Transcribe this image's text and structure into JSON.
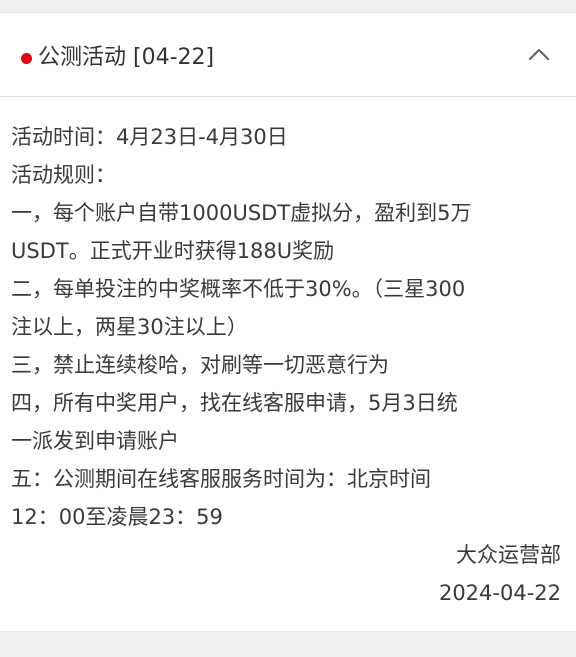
{
  "announcement": {
    "title": "公测活动 [04-22]",
    "accent_color": "#e60012",
    "expanded_icon": "chevron-up-icon",
    "lines": [
      "活动时间：4月23日-4月30日",
      "活动规则：",
      "一，每个账户自带1000USDT虚拟分，盈利到5万",
      "USDT。正式开业时获得188U奖励",
      "二，每单投注的中奖概率不低于30%。（三星300",
      "注以上，两星30注以上）",
      "三，禁止连续梭哈，对刷等一切恶意行为",
      "四，所有中奖用户，找在线客服申请，5月3日统",
      "一派发到申请账户",
      "五：公测期间在线客服服务时间为：北京时间",
      "12：00至凌晨23：59"
    ],
    "signature": "大众运营部",
    "date": "2024-04-22"
  }
}
